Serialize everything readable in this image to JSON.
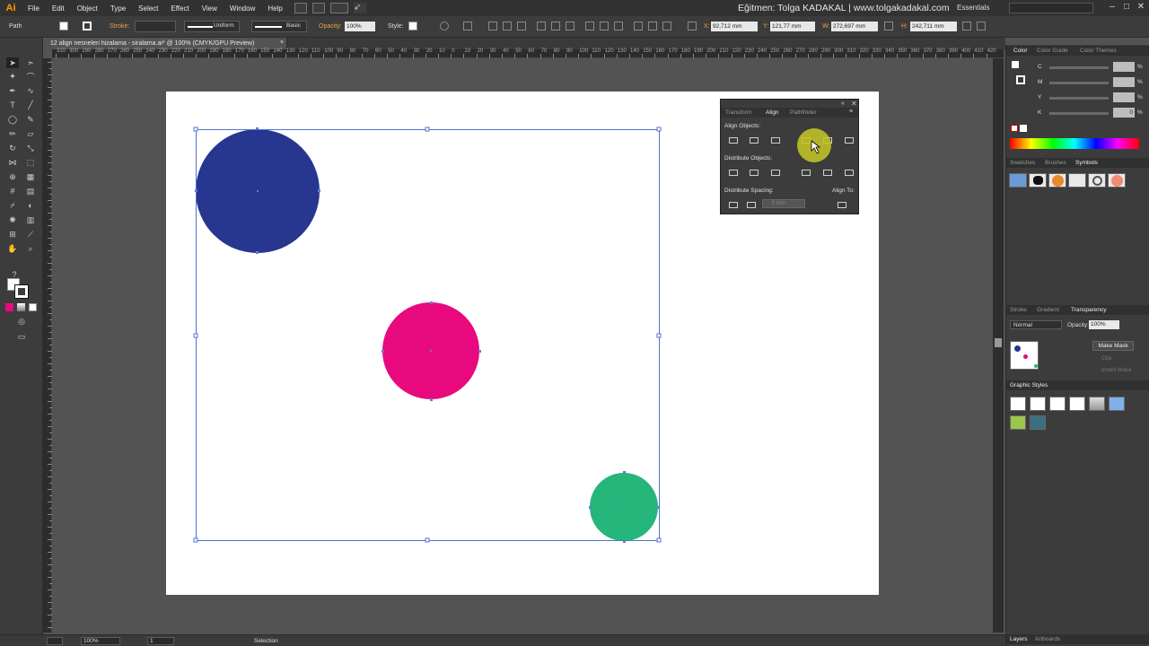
{
  "app": {
    "logo": "Ai",
    "menu": [
      "File",
      "Edit",
      "Object",
      "Type",
      "Select",
      "Effect",
      "View",
      "Window",
      "Help"
    ],
    "title_right": "Eğitmen: Tolga KADAKAL | www.tolgakadakal.com",
    "workspace": "Essentials",
    "window_buttons": [
      "–",
      "□",
      "✕"
    ]
  },
  "controlbar": {
    "selection_type": "Path",
    "stroke_label": "Stroke:",
    "stroke_profile": "Uniform",
    "brush": "Basic",
    "opacity_label": "Opacity:",
    "opacity_value": "100%",
    "style_label": "Style:",
    "x_label": "X:",
    "x_value": "92,712 mm",
    "y_label": "Y:",
    "y_value": "121,77 mm",
    "w_label": "W:",
    "w_value": "272,697 mm",
    "h_label": "H:",
    "h_value": "242,711 mm"
  },
  "document": {
    "tab_title": "12 align nesneleri hizalama - siralama.ai* @ 100% (CMYK/GPU Preview)",
    "tab_close": "×"
  },
  "ruler_top_labels": [
    "310",
    "300",
    "290",
    "280",
    "270",
    "260",
    "250",
    "240",
    "230",
    "220",
    "210",
    "200",
    "190",
    "180",
    "170",
    "160",
    "150",
    "140",
    "130",
    "120",
    "110",
    "100",
    "90",
    "80",
    "70",
    "60",
    "50",
    "40",
    "30",
    "20",
    "10",
    "0",
    "10",
    "20",
    "30",
    "40",
    "50",
    "60",
    "70",
    "80",
    "90",
    "100",
    "110",
    "120",
    "130",
    "140",
    "150",
    "160",
    "170",
    "180",
    "190",
    "200",
    "210",
    "220",
    "230",
    "240",
    "250",
    "260",
    "270",
    "280",
    "290",
    "300",
    "310",
    "320",
    "330",
    "340",
    "350",
    "360",
    "370",
    "380",
    "390",
    "400",
    "410",
    "420"
  ],
  "artwork": {
    "circles": [
      {
        "name": "blue-circle",
        "color": "#27368f"
      },
      {
        "name": "magenta-circle",
        "color": "#e8097e"
      },
      {
        "name": "green-circle",
        "color": "#24b67a"
      }
    ]
  },
  "align_panel": {
    "tabs": [
      "Transform",
      "Align",
      "Pathfinder"
    ],
    "active_tab": "Align",
    "align_objects_label": "Align Objects:",
    "distribute_objects_label": "Distribute Objects:",
    "distribute_spacing_label": "Distribute Spacing:",
    "align_to_label": "Align To:",
    "spacing_value": "0 mm",
    "align_buttons": [
      "horizontal-align-left",
      "horizontal-align-center",
      "horizontal-align-right",
      "vertical-align-top",
      "vertical-align-center",
      "vertical-align-bottom"
    ],
    "distribute_buttons": [
      "vertical-distribute-top",
      "vertical-distribute-center",
      "vertical-distribute-bottom",
      "horizontal-distribute-left",
      "horizontal-distribute-center",
      "horizontal-distribute-right"
    ]
  },
  "color_panel": {
    "tabs": [
      "Color",
      "Color Guide",
      "Color Themes"
    ],
    "rows": [
      {
        "label": "C",
        "value": ""
      },
      {
        "label": "M",
        "value": ""
      },
      {
        "label": "Y",
        "value": ""
      },
      {
        "label": "K",
        "value": "0"
      }
    ],
    "pct": "%"
  },
  "symbols_panel": {
    "tabs": [
      "Swatches",
      "Brushes",
      "Symbols"
    ],
    "active_tab": "Symbols"
  },
  "transparency_panel": {
    "tabs": [
      "Stroke",
      "Gradient",
      "Transparency"
    ],
    "active_tab": "Transparency",
    "blend_mode": "Normal",
    "opacity_label": "Opacity:",
    "opacity_value": "100%",
    "make_mask": "Make Mask",
    "clip": "Clip",
    "invert_mask": "Invert Mask"
  },
  "graphic_styles": {
    "title": "Graphic Styles"
  },
  "bottom_tabs": [
    "Layers",
    "Artboards"
  ],
  "statusbar": {
    "zoom": "100%",
    "artboard_number": "1",
    "tool_name": "Selection"
  },
  "colors": {
    "accent_orange": "#ff9a00",
    "cursor_highlight": "#c8c826"
  }
}
